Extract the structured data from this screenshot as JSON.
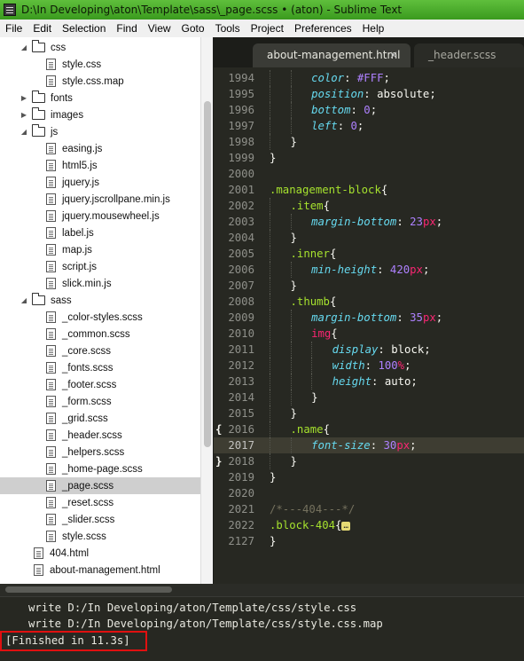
{
  "window": {
    "title": "D:\\In Developing\\aton\\Template\\sass\\_page.scss • (aton) - Sublime Text"
  },
  "menu": [
    "File",
    "Edit",
    "Selection",
    "Find",
    "View",
    "Goto",
    "Tools",
    "Project",
    "Preferences",
    "Help"
  ],
  "tabs": [
    {
      "label": "about-management.html",
      "active": true,
      "close": "×"
    },
    {
      "label": "_header.scss",
      "active": false
    }
  ],
  "sidebar": {
    "rows": [
      {
        "type": "folder",
        "open": true,
        "label": "css",
        "indent": 1
      },
      {
        "type": "file",
        "label": "style.css",
        "indent": 2
      },
      {
        "type": "file",
        "label": "style.css.map",
        "indent": 2
      },
      {
        "type": "folder",
        "open": false,
        "label": "fonts",
        "indent": 1
      },
      {
        "type": "folder",
        "open": false,
        "label": "images",
        "indent": 1
      },
      {
        "type": "folder",
        "open": true,
        "label": "js",
        "indent": 1
      },
      {
        "type": "file",
        "label": "easing.js",
        "indent": 2
      },
      {
        "type": "file",
        "label": "html5.js",
        "indent": 2
      },
      {
        "type": "file",
        "label": "jquery.js",
        "indent": 2
      },
      {
        "type": "file",
        "label": "jquery.jscrollpane.min.js",
        "indent": 2
      },
      {
        "type": "file",
        "label": "jquery.mousewheel.js",
        "indent": 2
      },
      {
        "type": "file",
        "label": "label.js",
        "indent": 2
      },
      {
        "type": "file",
        "label": "map.js",
        "indent": 2
      },
      {
        "type": "file",
        "label": "script.js",
        "indent": 2
      },
      {
        "type": "file",
        "label": "slick.min.js",
        "indent": 2
      },
      {
        "type": "folder",
        "open": true,
        "label": "sass",
        "indent": 1
      },
      {
        "type": "file",
        "label": "_color-styles.scss",
        "indent": 2
      },
      {
        "type": "file",
        "label": "_common.scss",
        "indent": 2
      },
      {
        "type": "file",
        "label": "_core.scss",
        "indent": 2
      },
      {
        "type": "file",
        "label": "_fonts.scss",
        "indent": 2
      },
      {
        "type": "file",
        "label": "_footer.scss",
        "indent": 2
      },
      {
        "type": "file",
        "label": "_form.scss",
        "indent": 2
      },
      {
        "type": "file",
        "label": "_grid.scss",
        "indent": 2
      },
      {
        "type": "file",
        "label": "_header.scss",
        "indent": 2
      },
      {
        "type": "file",
        "label": "_helpers.scss",
        "indent": 2
      },
      {
        "type": "file",
        "label": "_home-page.scss",
        "indent": 2
      },
      {
        "type": "file",
        "label": "_page.scss",
        "indent": 2,
        "selected": true
      },
      {
        "type": "file",
        "label": "_reset.scss",
        "indent": 2
      },
      {
        "type": "file",
        "label": "_slider.scss",
        "indent": 2
      },
      {
        "type": "file",
        "label": "style.scss",
        "indent": 2
      },
      {
        "type": "file",
        "label": "404.html",
        "indent": 1
      },
      {
        "type": "file",
        "label": "about-management.html",
        "indent": 1
      }
    ]
  },
  "editor": {
    "lines": [
      {
        "n": "1994",
        "indent": 2,
        "tokens": [
          [
            "prop",
            "color"
          ],
          [
            "plain",
            ": "
          ],
          [
            "num",
            "#FFF"
          ],
          [
            "plain",
            ";"
          ]
        ]
      },
      {
        "n": "1995",
        "indent": 2,
        "tokens": [
          [
            "prop",
            "position"
          ],
          [
            "plain",
            ": absolute;"
          ]
        ]
      },
      {
        "n": "1996",
        "indent": 2,
        "tokens": [
          [
            "prop",
            "bottom"
          ],
          [
            "plain",
            ": "
          ],
          [
            "num",
            "0"
          ],
          [
            "plain",
            ";"
          ]
        ]
      },
      {
        "n": "1997",
        "indent": 2,
        "tokens": [
          [
            "prop",
            "left"
          ],
          [
            "plain",
            ": "
          ],
          [
            "num",
            "0"
          ],
          [
            "plain",
            ";"
          ]
        ]
      },
      {
        "n": "1998",
        "indent": 1,
        "tokens": [
          [
            "plain",
            "}"
          ]
        ]
      },
      {
        "n": "1999",
        "indent": 0,
        "tokens": [
          [
            "plain",
            "}"
          ]
        ]
      },
      {
        "n": "2000",
        "indent": 0,
        "tokens": []
      },
      {
        "n": "2001",
        "indent": 0,
        "tokens": [
          [
            "sel",
            ".management-block"
          ],
          [
            "plain",
            "{"
          ]
        ]
      },
      {
        "n": "2002",
        "indent": 1,
        "tokens": [
          [
            "sel",
            ".item"
          ],
          [
            "plain",
            "{"
          ]
        ]
      },
      {
        "n": "2003",
        "indent": 2,
        "tokens": [
          [
            "prop",
            "margin-bottom"
          ],
          [
            "plain",
            ": "
          ],
          [
            "num",
            "23"
          ],
          [
            "unit",
            "px"
          ],
          [
            "plain",
            ";"
          ]
        ]
      },
      {
        "n": "2004",
        "indent": 1,
        "tokens": [
          [
            "plain",
            "}"
          ]
        ]
      },
      {
        "n": "2005",
        "indent": 1,
        "tokens": [
          [
            "sel",
            ".inner"
          ],
          [
            "plain",
            "{"
          ]
        ]
      },
      {
        "n": "2006",
        "indent": 2,
        "tokens": [
          [
            "prop",
            "min-height"
          ],
          [
            "plain",
            ": "
          ],
          [
            "num",
            "420"
          ],
          [
            "unit",
            "px"
          ],
          [
            "plain",
            ";"
          ]
        ]
      },
      {
        "n": "2007",
        "indent": 1,
        "tokens": [
          [
            "plain",
            "}"
          ]
        ]
      },
      {
        "n": "2008",
        "indent": 1,
        "tokens": [
          [
            "sel",
            ".thumb"
          ],
          [
            "plain",
            "{"
          ]
        ]
      },
      {
        "n": "2009",
        "indent": 2,
        "tokens": [
          [
            "prop",
            "margin-bottom"
          ],
          [
            "plain",
            ": "
          ],
          [
            "num",
            "35"
          ],
          [
            "unit",
            "px"
          ],
          [
            "plain",
            ";"
          ]
        ]
      },
      {
        "n": "2010",
        "indent": 2,
        "tokens": [
          [
            "tag",
            "img"
          ],
          [
            "plain",
            "{"
          ]
        ]
      },
      {
        "n": "2011",
        "indent": 3,
        "tokens": [
          [
            "prop",
            "display"
          ],
          [
            "plain",
            ": block;"
          ]
        ]
      },
      {
        "n": "2012",
        "indent": 3,
        "tokens": [
          [
            "prop",
            "width"
          ],
          [
            "plain",
            ": "
          ],
          [
            "num",
            "100"
          ],
          [
            "unit",
            "%"
          ],
          [
            "plain",
            ";"
          ]
        ]
      },
      {
        "n": "2013",
        "indent": 3,
        "tokens": [
          [
            "prop",
            "height"
          ],
          [
            "plain",
            ": auto;"
          ]
        ]
      },
      {
        "n": "2014",
        "indent": 2,
        "tokens": [
          [
            "plain",
            "}"
          ]
        ]
      },
      {
        "n": "2015",
        "indent": 1,
        "tokens": [
          [
            "plain",
            "}"
          ]
        ]
      },
      {
        "n": "2016",
        "indent": 1,
        "fold": "{",
        "tokens": [
          [
            "sel",
            ".name"
          ],
          [
            "plain",
            "{"
          ]
        ]
      },
      {
        "n": "2017",
        "indent": 2,
        "current": true,
        "tokens": [
          [
            "prop",
            "font-size"
          ],
          [
            "plain",
            ": "
          ],
          [
            "num",
            "30"
          ],
          [
            "unit",
            "px"
          ],
          [
            "plain",
            ";"
          ]
        ]
      },
      {
        "n": "2018",
        "indent": 1,
        "fold": "}",
        "tokens": [
          [
            "plain",
            "}"
          ]
        ]
      },
      {
        "n": "2019",
        "indent": 0,
        "tokens": [
          [
            "plain",
            "}"
          ]
        ]
      },
      {
        "n": "2020",
        "indent": 0,
        "tokens": []
      },
      {
        "n": "2021",
        "indent": 0,
        "tokens": [
          [
            "cmt",
            "/*---404---*/"
          ]
        ]
      },
      {
        "n": "2022",
        "indent": 0,
        "tokens": [
          [
            "sel",
            ".block-404"
          ],
          [
            "plain",
            "{"
          ],
          [
            "ell",
            "…"
          ]
        ]
      },
      {
        "n": "2127",
        "indent": 0,
        "tokens": [
          [
            "plain",
            "}"
          ]
        ]
      }
    ]
  },
  "console": {
    "lines": [
      "write D:/In Developing/aton/Template/css/style.css",
      "write D:/In Developing/aton/Template/css/style.css.map"
    ],
    "finished": "[Finished in 11.3s]"
  }
}
